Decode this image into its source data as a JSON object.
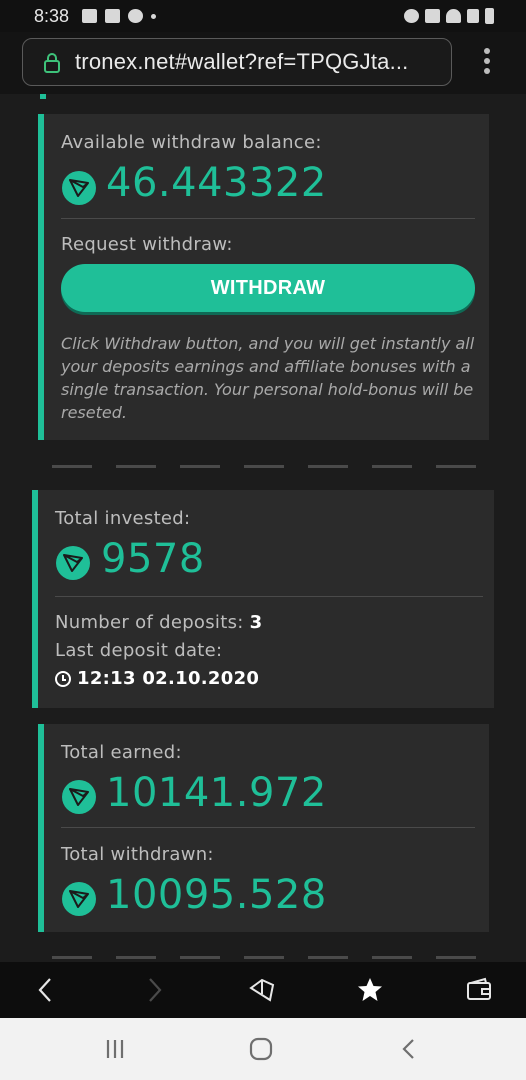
{
  "status_bar": {
    "time": "8:38"
  },
  "browser": {
    "url": "tronex.net#wallet?ref=TPQGJta..."
  },
  "withdraw_card": {
    "balance_label": "Available withdraw balance:",
    "balance_value": "46.443322",
    "request_label": "Request withdraw:",
    "button_label": "WITHDRAW",
    "note": "Click Withdraw button, and you will get instantly all your deposits earnings and affiliate bonuses with a single transaction. Your personal hold-bonus will be reseted."
  },
  "invested_card": {
    "invested_label": "Total invested:",
    "invested_value": "9578",
    "deposits_label": "Number of deposits:",
    "deposits_value": "3",
    "last_deposit_label": "Last deposit date:",
    "last_deposit_value": "12:13 02.10.2020"
  },
  "earned_card": {
    "earned_label": "Total earned:",
    "earned_value": "10141.972",
    "withdrawn_label": "Total withdrawn:",
    "withdrawn_value": "10095.528"
  },
  "colors": {
    "accent": "#1fbf98",
    "card_bg": "#2b2b2b",
    "page_bg": "#1c1c1c"
  },
  "icons": [
    "tron-coin-icon",
    "clock-icon",
    "lock-icon",
    "back-icon",
    "forward-icon",
    "vpn-shield-icon",
    "bookmark-star-icon",
    "wallet-icon"
  ]
}
